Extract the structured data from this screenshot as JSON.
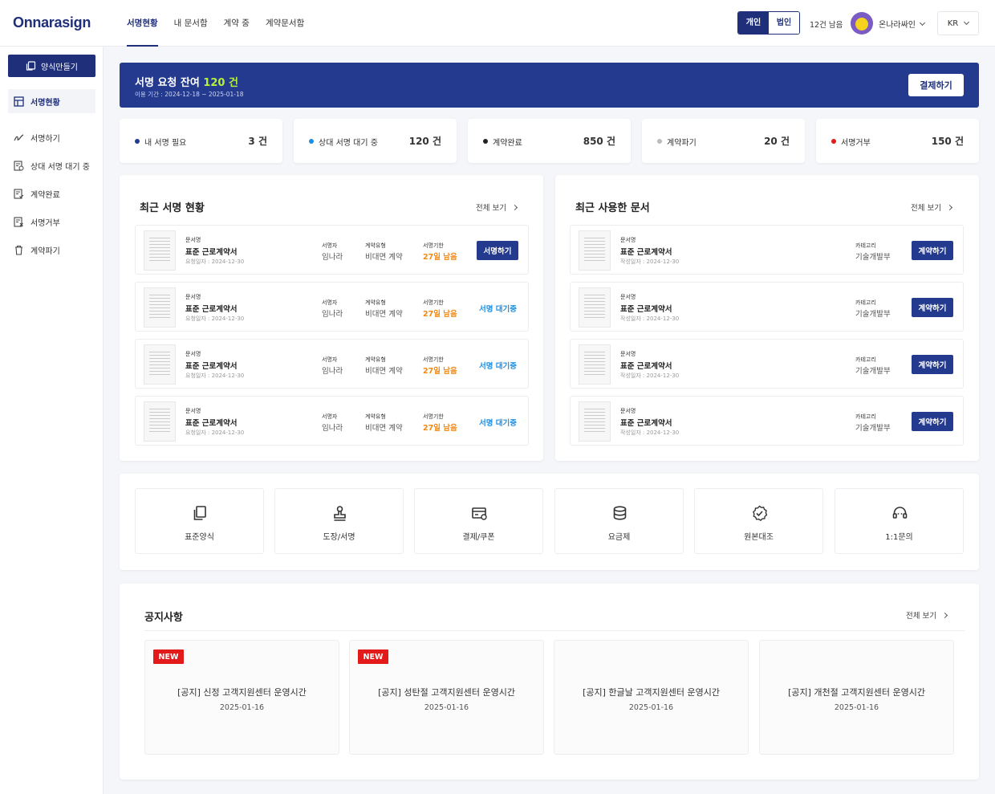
{
  "brand": {
    "logo": "Onnarasign"
  },
  "topnav": {
    "items": [
      "서명현황",
      "내 문서함",
      "계약 중",
      "계약문서함"
    ]
  },
  "header": {
    "toggle": [
      "개인",
      "법인"
    ],
    "remaining": "12건 남음",
    "user_name": "온나라싸인",
    "language": "KR"
  },
  "sidebar": {
    "make_button": "양식만들기",
    "items": [
      "서명현황",
      "서명하기",
      "상대 서명 대기 중",
      "계약완료",
      "서명거부",
      "계약파기"
    ]
  },
  "banner": {
    "title_prefix": "서명 요청 잔여",
    "title_count": "120 건",
    "period": "이용 기간 : 2024-12-18 ~ 2025-01-18",
    "pay_button": "결제하기"
  },
  "stats": [
    {
      "label": "내 서명 필요",
      "value": "3 건",
      "color": "#243a8f"
    },
    {
      "label": "상대 서명 대기 중",
      "value": "120 건",
      "color": "#1f8ee0"
    },
    {
      "label": "계약완료",
      "value": "850 건",
      "color": "#222222"
    },
    {
      "label": "계약파기",
      "value": "20 건",
      "color": "#bbbbbb"
    },
    {
      "label": "서명거부",
      "value": "150 건",
      "color": "#e31a1a"
    }
  ],
  "recent_sign": {
    "title": "최근 서명 현황",
    "view_all": "전체 보기",
    "rows": [
      {
        "doc_caption": "문서명",
        "doc_name": "표준 근로계약서",
        "doc_date": "요청일자 : 2024-12-30",
        "signer_caption": "서명자",
        "signer": "임나라",
        "type_caption": "계약유형",
        "type": "비대면 계약",
        "deadline_caption": "서명기한",
        "deadline": "27일 남음",
        "action": "서명하기"
      },
      {
        "doc_caption": "문서명",
        "doc_name": "표준 근로계약서",
        "doc_date": "요청일자 : 2024-12-30",
        "signer_caption": "서명자",
        "signer": "임나라",
        "type_caption": "계약유형",
        "type": "비대면 계약",
        "deadline_caption": "서명기한",
        "deadline": "27일 남음",
        "action": "서명 대기중"
      },
      {
        "doc_caption": "문서명",
        "doc_name": "표준 근로계약서",
        "doc_date": "요청일자 : 2024-12-30",
        "signer_caption": "서명자",
        "signer": "임나라",
        "type_caption": "계약유형",
        "type": "비대면 계약",
        "deadline_caption": "서명기한",
        "deadline": "27일 남음",
        "action": "서명 대기중"
      },
      {
        "doc_caption": "문서명",
        "doc_name": "표준 근로계약서",
        "doc_date": "요청일자 : 2024-12-30",
        "signer_caption": "서명자",
        "signer": "임나라",
        "type_caption": "계약유형",
        "type": "비대면 계약",
        "deadline_caption": "서명기한",
        "deadline": "27일 남음",
        "action": "서명 대기중"
      }
    ]
  },
  "recent_docs": {
    "title": "최근 사용한 문서",
    "view_all": "전체 보기",
    "rows": [
      {
        "doc_caption": "문서명",
        "doc_name": "표준 근로계약서",
        "doc_date": "작성일자 : 2024-12-30",
        "cat_caption": "카테고리",
        "category": "기술개발부",
        "action": "계약하기"
      },
      {
        "doc_caption": "문서명",
        "doc_name": "표준 근로계약서",
        "doc_date": "작성일자 : 2024-12-30",
        "cat_caption": "카테고리",
        "category": "기술개발부",
        "action": "계약하기"
      },
      {
        "doc_caption": "문서명",
        "doc_name": "표준 근로계약서",
        "doc_date": "작성일자 : 2024-12-30",
        "cat_caption": "카테고리",
        "category": "기술개발부",
        "action": "계약하기"
      },
      {
        "doc_caption": "문서명",
        "doc_name": "표준 근로계약서",
        "doc_date": "작성일자 : 2024-12-30",
        "cat_caption": "카테고리",
        "category": "기술개발부",
        "action": "계약하기"
      }
    ]
  },
  "quick_menu": [
    {
      "label": "표준양식",
      "icon": "copy-icon"
    },
    {
      "label": "도장/서명",
      "icon": "stamp-icon"
    },
    {
      "label": "결제/쿠폰",
      "icon": "payment-card-icon"
    },
    {
      "label": "요금제",
      "icon": "coins-icon"
    },
    {
      "label": "원본대조",
      "icon": "verified-badge-icon"
    },
    {
      "label": "1:1문의",
      "icon": "headset-icon"
    }
  ],
  "notices": {
    "title": "공지사항",
    "view_all": "전체 보기",
    "items": [
      {
        "badge": "NEW",
        "title": "[공지] 신정 고객지원센터 운영시간",
        "date": "2025-01-16"
      },
      {
        "badge": "NEW",
        "title": "[공지] 성탄절 고객지원센터 운영시간",
        "date": "2025-01-16"
      },
      {
        "badge": "",
        "title": "[공지] 한글날 고객지원센터 운영시간",
        "date": "2025-01-16"
      },
      {
        "badge": "",
        "title": "[공지] 개천절 고객지원센터 운영시간",
        "date": "2025-01-16"
      }
    ]
  }
}
